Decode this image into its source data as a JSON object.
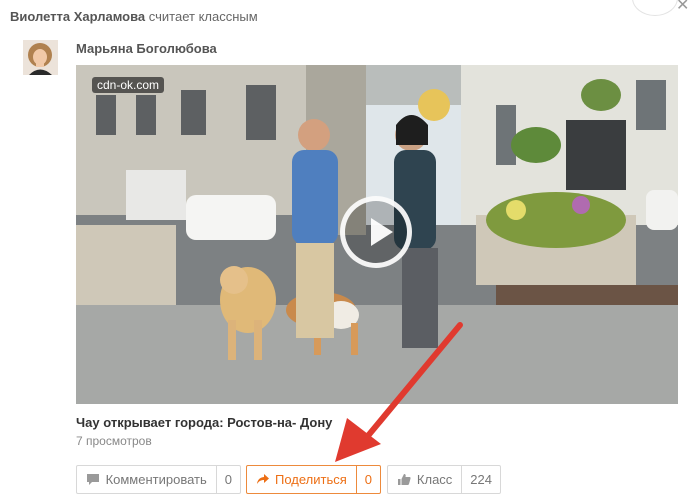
{
  "header": {
    "liker_name": "Виолетта Харламова",
    "action_text": "считает классным"
  },
  "post": {
    "author_name": "Марьяна Боголюбова",
    "video": {
      "source_label": "cdn-ok.com"
    },
    "title": "Чау открывает города: Ростов-на- Дону",
    "views": "7 просмотров"
  },
  "actions": {
    "comment": {
      "label": "Комментировать",
      "count": "0",
      "icon": "speech-bubble-icon"
    },
    "share": {
      "label": "Поделиться",
      "count": "0",
      "icon": "share-arrow-icon"
    },
    "like": {
      "label": "Класс",
      "count": "224",
      "icon": "thumbs-up-icon"
    }
  },
  "colors": {
    "accent": "#ed6f15",
    "annotation_arrow": "#e03a2f"
  }
}
